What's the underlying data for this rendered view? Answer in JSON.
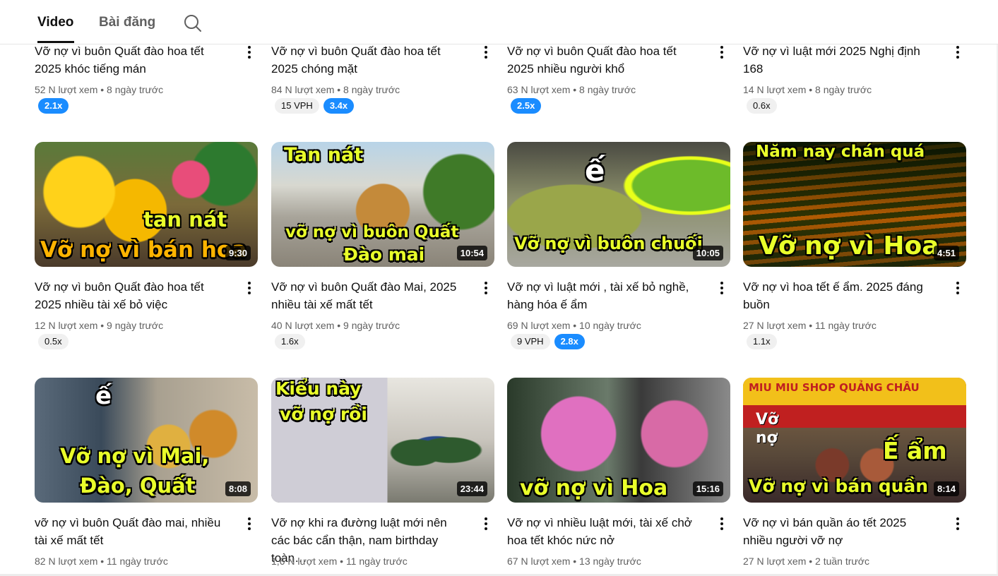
{
  "tabs": {
    "video": "Video",
    "posts": "Bài đăng"
  },
  "row1": [
    {
      "title": "Vỡ nợ vì buôn Quất đào hoa tết 2025 khóc tiếng mán",
      "views": "52 N lượt xem",
      "sep": "•",
      "age": "8 ngày trước",
      "vph": "",
      "ratio": "2.1x",
      "ratio_style": "blue"
    },
    {
      "title": "Vỡ nợ vì buôn Quất đào hoa tết 2025 chóng mặt",
      "views": "84 N lượt xem",
      "sep": "•",
      "age": "8 ngày trước",
      "vph": "15 VPH",
      "ratio": "3.4x",
      "ratio_style": "blue"
    },
    {
      "title": "Vỡ nợ vì buôn Quất đào hoa tết 2025 nhiều người khổ",
      "views": "63 N lượt xem",
      "sep": "•",
      "age": "8 ngày trước",
      "vph": "",
      "ratio": "2.5x",
      "ratio_style": "blue"
    },
    {
      "title": "Vỡ nợ vì luật mới 2025 Nghị định 168",
      "views": "14 N lượt xem",
      "sep": "•",
      "age": "8 ngày trước",
      "vph": "",
      "ratio": "0.6x",
      "ratio_style": "grey"
    }
  ],
  "row2": [
    {
      "title": "Vỡ nợ vì buôn Quất đào hoa tết 2025 nhiều tài xế bỏ việc",
      "views": "12 N lượt xem",
      "sep": "•",
      "age": "9 ngày trước",
      "vph": "",
      "ratio": "0.5x",
      "ratio_style": "grey",
      "duration": "9:30",
      "caption1": "tan nát",
      "caption2": "Vỡ nợ vì bán hoa"
    },
    {
      "title": "Vỡ nợ vì buôn Quất đào Mai, 2025 nhiều tài xế mất tết",
      "views": "40 N lượt xem",
      "sep": "•",
      "age": "9 ngày trước",
      "vph": "",
      "ratio": "1.6x",
      "ratio_style": "grey",
      "duration": "10:54",
      "caption1": "Tan nát",
      "caption2": "vỡ nợ vì buôn Quất",
      "caption3": "Đào mai"
    },
    {
      "title": "Vỡ nợ vì luật mới , tài xế bỏ nghề, hàng hóa ế ẩm",
      "views": "69 N lượt xem",
      "sep": "•",
      "age": "10 ngày trước",
      "vph": "9 VPH",
      "ratio": "2.8x",
      "ratio_style": "blue",
      "duration": "10:05",
      "caption1": "ế",
      "caption2": "Vỡ nợ vì buôn chuối"
    },
    {
      "title": "Vỡ nợ vì hoa tết ế ẩm. 2025 đáng buồn",
      "views": "27 N lượt xem",
      "sep": "•",
      "age": "11 ngày trước",
      "vph": "",
      "ratio": "1.1x",
      "ratio_style": "grey",
      "duration": "4:51",
      "caption1": "Năm nay chán quá",
      "caption2": "Vỡ nợ vì Hoa"
    }
  ],
  "row3": [
    {
      "title": "vỡ nợ vì buôn Quất đào mai, nhiều tài xế mất tết",
      "views": "82 N lượt xem",
      "sep": "•",
      "age": "11 ngày trước",
      "duration": "8:08",
      "caption1": "ế",
      "caption2": "Vỡ nợ vì Mai,",
      "caption3": "Đào, Quất"
    },
    {
      "title": "Vỡ nợ khi ra đường luật mới nên các bác cẩn thận, nam birthday toàn…",
      "views": "1,6 N lượt xem",
      "sep": "•",
      "age": "11 ngày trước",
      "duration": "23:44",
      "caption1": "Kiểu này",
      "caption2": "vỡ nợ rồi"
    },
    {
      "title": "Vỡ nợ vì nhiều luật mới, tài xế chở hoa tết khóc nức nở",
      "views": "67 N lượt xem",
      "sep": "•",
      "age": "13 ngày trước",
      "duration": "15:16",
      "caption1": "vỡ nợ vì Hoa"
    },
    {
      "title": "Vỡ nợ vì bán quần áo tết 2025 nhiều người vỡ nợ",
      "views": "27 N lượt xem",
      "sep": "•",
      "age": "2 tuần trước",
      "duration": "8:14",
      "caption1": "MIU MIU SHOP QUẢNG CHÂU",
      "caption2": "Ế ẩm",
      "caption3": "Vỡ nợ vì bán quần",
      "caption4": "Vỡ",
      "caption5": "nợ"
    }
  ],
  "icons": {
    "search": "search-icon",
    "more": "more-vert-icon"
  },
  "colors": {
    "badge_blue": "#1a8cff",
    "badge_grey": "#f0f0f0",
    "caption_yellow": "#e9ff2a"
  }
}
